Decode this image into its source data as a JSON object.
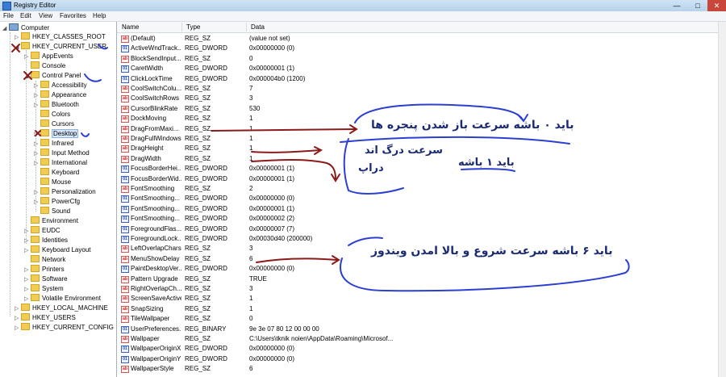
{
  "window": {
    "title": "Registry Editor"
  },
  "menu": [
    "File",
    "Edit",
    "View",
    "Favorites",
    "Help"
  ],
  "tree": {
    "root": "Computer",
    "nodes": [
      "HKEY_CLASSES_ROOT",
      "HKEY_CURRENT_USER",
      "AppEvents",
      "Console",
      "Control Panel",
      "Accessibility",
      "Appearance",
      "Bluetooth",
      "Colors",
      "Cursors",
      "Desktop",
      "Infrared",
      "Input Method",
      "International",
      "Keyboard",
      "Mouse",
      "Personalization",
      "PowerCfg",
      "Sound",
      "Environment",
      "EUDC",
      "Identities",
      "Keyboard Layout",
      "Network",
      "Printers",
      "Software",
      "System",
      "Volatile Environment",
      "HKEY_LOCAL_MACHINE",
      "HKEY_USERS",
      "HKEY_CURRENT_CONFIG"
    ]
  },
  "list": {
    "columns": [
      "Name",
      "Type",
      "Data"
    ],
    "rows": [
      {
        "name": "(Default)",
        "type": "REG_SZ",
        "data": "(value not set)",
        "icon": "string-value-icon"
      },
      {
        "name": "ActiveWndTrack...",
        "type": "REG_DWORD",
        "data": "0x00000000 (0)",
        "icon": "binary-value-icon"
      },
      {
        "name": "BlockSendInput...",
        "type": "REG_SZ",
        "data": "0",
        "icon": "string-value-icon"
      },
      {
        "name": "CaretWidth",
        "type": "REG_DWORD",
        "data": "0x00000001 (1)",
        "icon": "binary-value-icon"
      },
      {
        "name": "ClickLockTime",
        "type": "REG_DWORD",
        "data": "0x000004b0 (1200)",
        "icon": "binary-value-icon"
      },
      {
        "name": "CoolSwitchColu...",
        "type": "REG_SZ",
        "data": "7",
        "icon": "string-value-icon"
      },
      {
        "name": "CoolSwitchRows",
        "type": "REG_SZ",
        "data": "3",
        "icon": "string-value-icon"
      },
      {
        "name": "CursorBlinkRate",
        "type": "REG_SZ",
        "data": "530",
        "icon": "string-value-icon"
      },
      {
        "name": "DockMoving",
        "type": "REG_SZ",
        "data": "1",
        "icon": "string-value-icon"
      },
      {
        "name": "DragFromMaxi...",
        "type": "REG_SZ",
        "data": "1",
        "icon": "string-value-icon"
      },
      {
        "name": "DragFullWindows",
        "type": "REG_SZ",
        "data": "1",
        "icon": "string-value-icon"
      },
      {
        "name": "DragHeight",
        "type": "REG_SZ",
        "data": "1",
        "icon": "string-value-icon"
      },
      {
        "name": "DragWidth",
        "type": "REG_SZ",
        "data": "1",
        "icon": "string-value-icon"
      },
      {
        "name": "FocusBorderHei...",
        "type": "REG_DWORD",
        "data": "0x00000001 (1)",
        "icon": "binary-value-icon"
      },
      {
        "name": "FocusBorderWid...",
        "type": "REG_DWORD",
        "data": "0x00000001 (1)",
        "icon": "binary-value-icon"
      },
      {
        "name": "FontSmoothing",
        "type": "REG_SZ",
        "data": "2",
        "icon": "string-value-icon"
      },
      {
        "name": "FontSmoothing...",
        "type": "REG_DWORD",
        "data": "0x00000000 (0)",
        "icon": "binary-value-icon"
      },
      {
        "name": "FontSmoothing...",
        "type": "REG_DWORD",
        "data": "0x00000001 (1)",
        "icon": "binary-value-icon"
      },
      {
        "name": "FontSmoothing...",
        "type": "REG_DWORD",
        "data": "0x00000002 (2)",
        "icon": "binary-value-icon"
      },
      {
        "name": "ForegroundFlas...",
        "type": "REG_DWORD",
        "data": "0x00000007 (7)",
        "icon": "binary-value-icon"
      },
      {
        "name": "ForegroundLock...",
        "type": "REG_DWORD",
        "data": "0x00030d40 (200000)",
        "icon": "binary-value-icon"
      },
      {
        "name": "LeftOverlapChars",
        "type": "REG_SZ",
        "data": "3",
        "icon": "string-value-icon"
      },
      {
        "name": "MenuShowDelay",
        "type": "REG_SZ",
        "data": "6",
        "icon": "string-value-icon"
      },
      {
        "name": "PaintDesktopVer...",
        "type": "REG_DWORD",
        "data": "0x00000000 (0)",
        "icon": "binary-value-icon"
      },
      {
        "name": "Pattern Upgrade",
        "type": "REG_SZ",
        "data": "TRUE",
        "icon": "string-value-icon"
      },
      {
        "name": "RightOverlapCh...",
        "type": "REG_SZ",
        "data": "3",
        "icon": "string-value-icon"
      },
      {
        "name": "ScreenSaveActive",
        "type": "REG_SZ",
        "data": "1",
        "icon": "string-value-icon"
      },
      {
        "name": "SnapSizing",
        "type": "REG_SZ",
        "data": "1",
        "icon": "string-value-icon"
      },
      {
        "name": "TileWallpaper",
        "type": "REG_SZ",
        "data": "0",
        "icon": "string-value-icon"
      },
      {
        "name": "UserPreferences...",
        "type": "REG_BINARY",
        "data": "9e 3e 07 80 12 00 00 00",
        "icon": "binary-value-icon"
      },
      {
        "name": "Wallpaper",
        "type": "REG_SZ",
        "data": "C:\\Users\\tknik noien\\AppData\\Roaming\\Microsof...",
        "icon": "string-value-icon"
      },
      {
        "name": "WallpaperOriginX",
        "type": "REG_DWORD",
        "data": "0x00000000 (0)",
        "icon": "binary-value-icon"
      },
      {
        "name": "WallpaperOriginY",
        "type": "REG_DWORD",
        "data": "0x00000000 (0)",
        "icon": "binary-value-icon"
      },
      {
        "name": "WallpaperStyle",
        "type": "REG_SZ",
        "data": "6",
        "icon": "string-value-icon"
      }
    ]
  },
  "annotations": {
    "note1": "باید ۰ باشه سرعت باز شدن پنجره ها",
    "note2a": "سرعت درگ اند",
    "note2b": "دراپ",
    "note3": "باید ۱ باشه",
    "note4": "باید ۶ باشه سرعت شروع و بالا امدن ویندوز"
  },
  "colors": {
    "annotation_red": "#8b1a1a",
    "annotation_blue": "#2c3fd1",
    "annotation_text": "#1b2a73"
  }
}
